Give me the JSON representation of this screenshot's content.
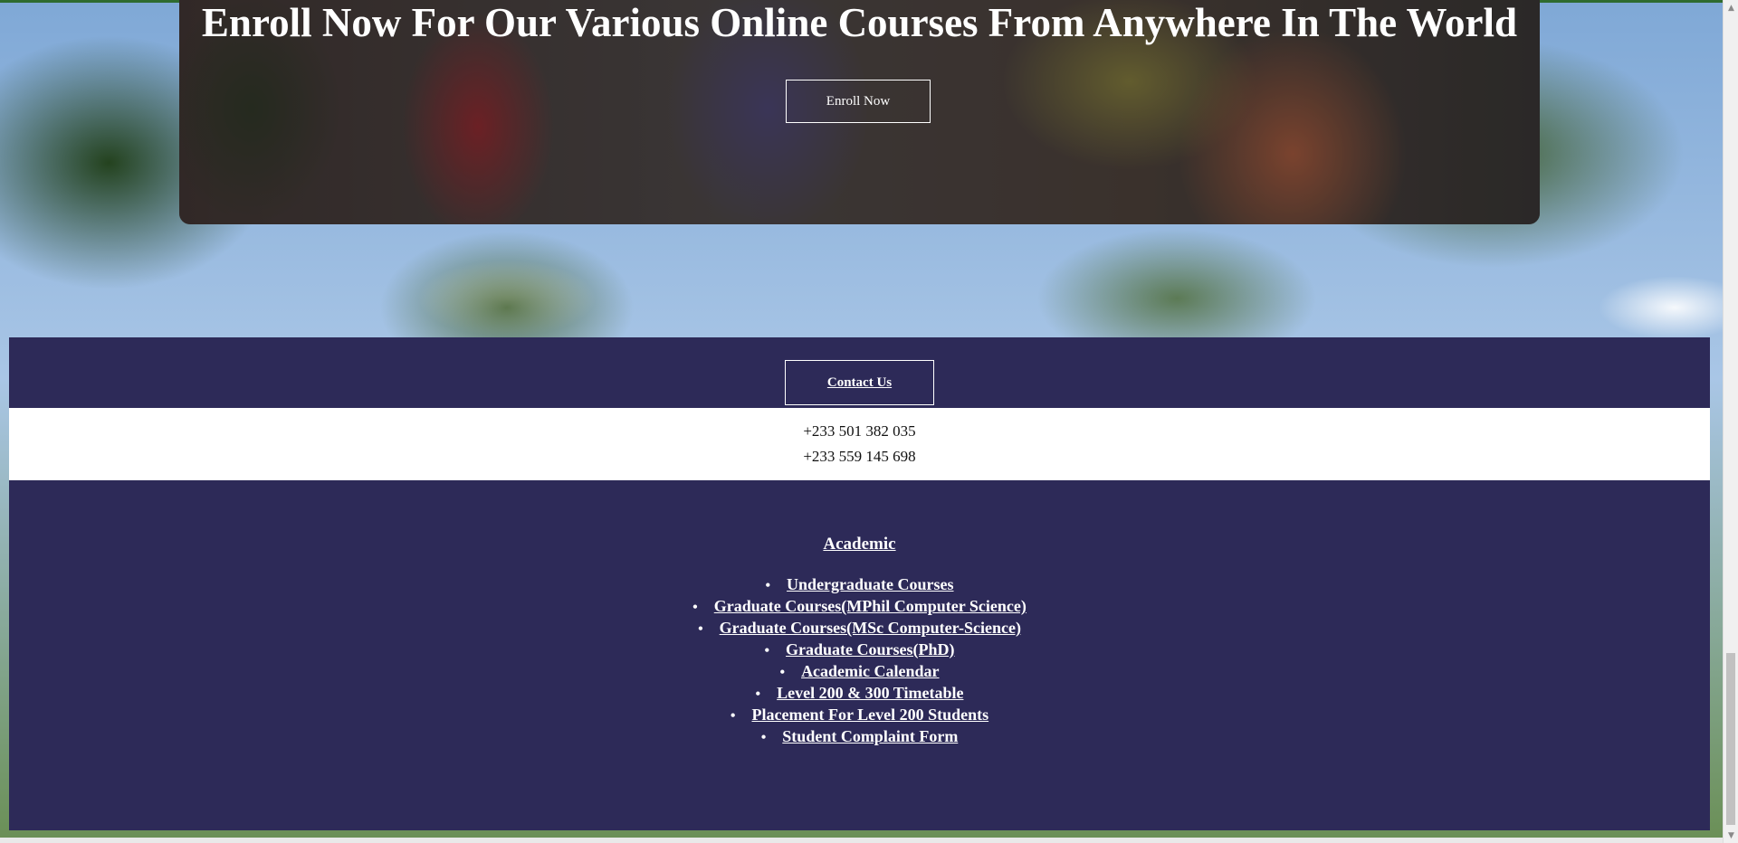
{
  "hero": {
    "title": "Enroll Now For Our Various Online Courses From Anywhere In The World",
    "enroll_label": "Enroll Now"
  },
  "footer": {
    "contact_label": "Contact Us",
    "phones": [
      "+233 501 382 035",
      "+233 559 145 698"
    ],
    "academic": {
      "heading": "Academic",
      "items": [
        "Undergraduate Courses",
        "Graduate Courses(MPhil Computer Science)",
        "Graduate Courses(MSc Computer-Science)",
        "Graduate Courses(PhD)",
        "Academic Calendar",
        "Level 200 & 300 Timetable",
        "Placement For Level 200 Students",
        "Student Complaint Form"
      ]
    }
  },
  "colors": {
    "footer_bg": "#2d2a58",
    "text_light": "#ffffff"
  },
  "icons": {
    "bullet": "•",
    "scroll_up": "▲",
    "scroll_down": "▼"
  }
}
